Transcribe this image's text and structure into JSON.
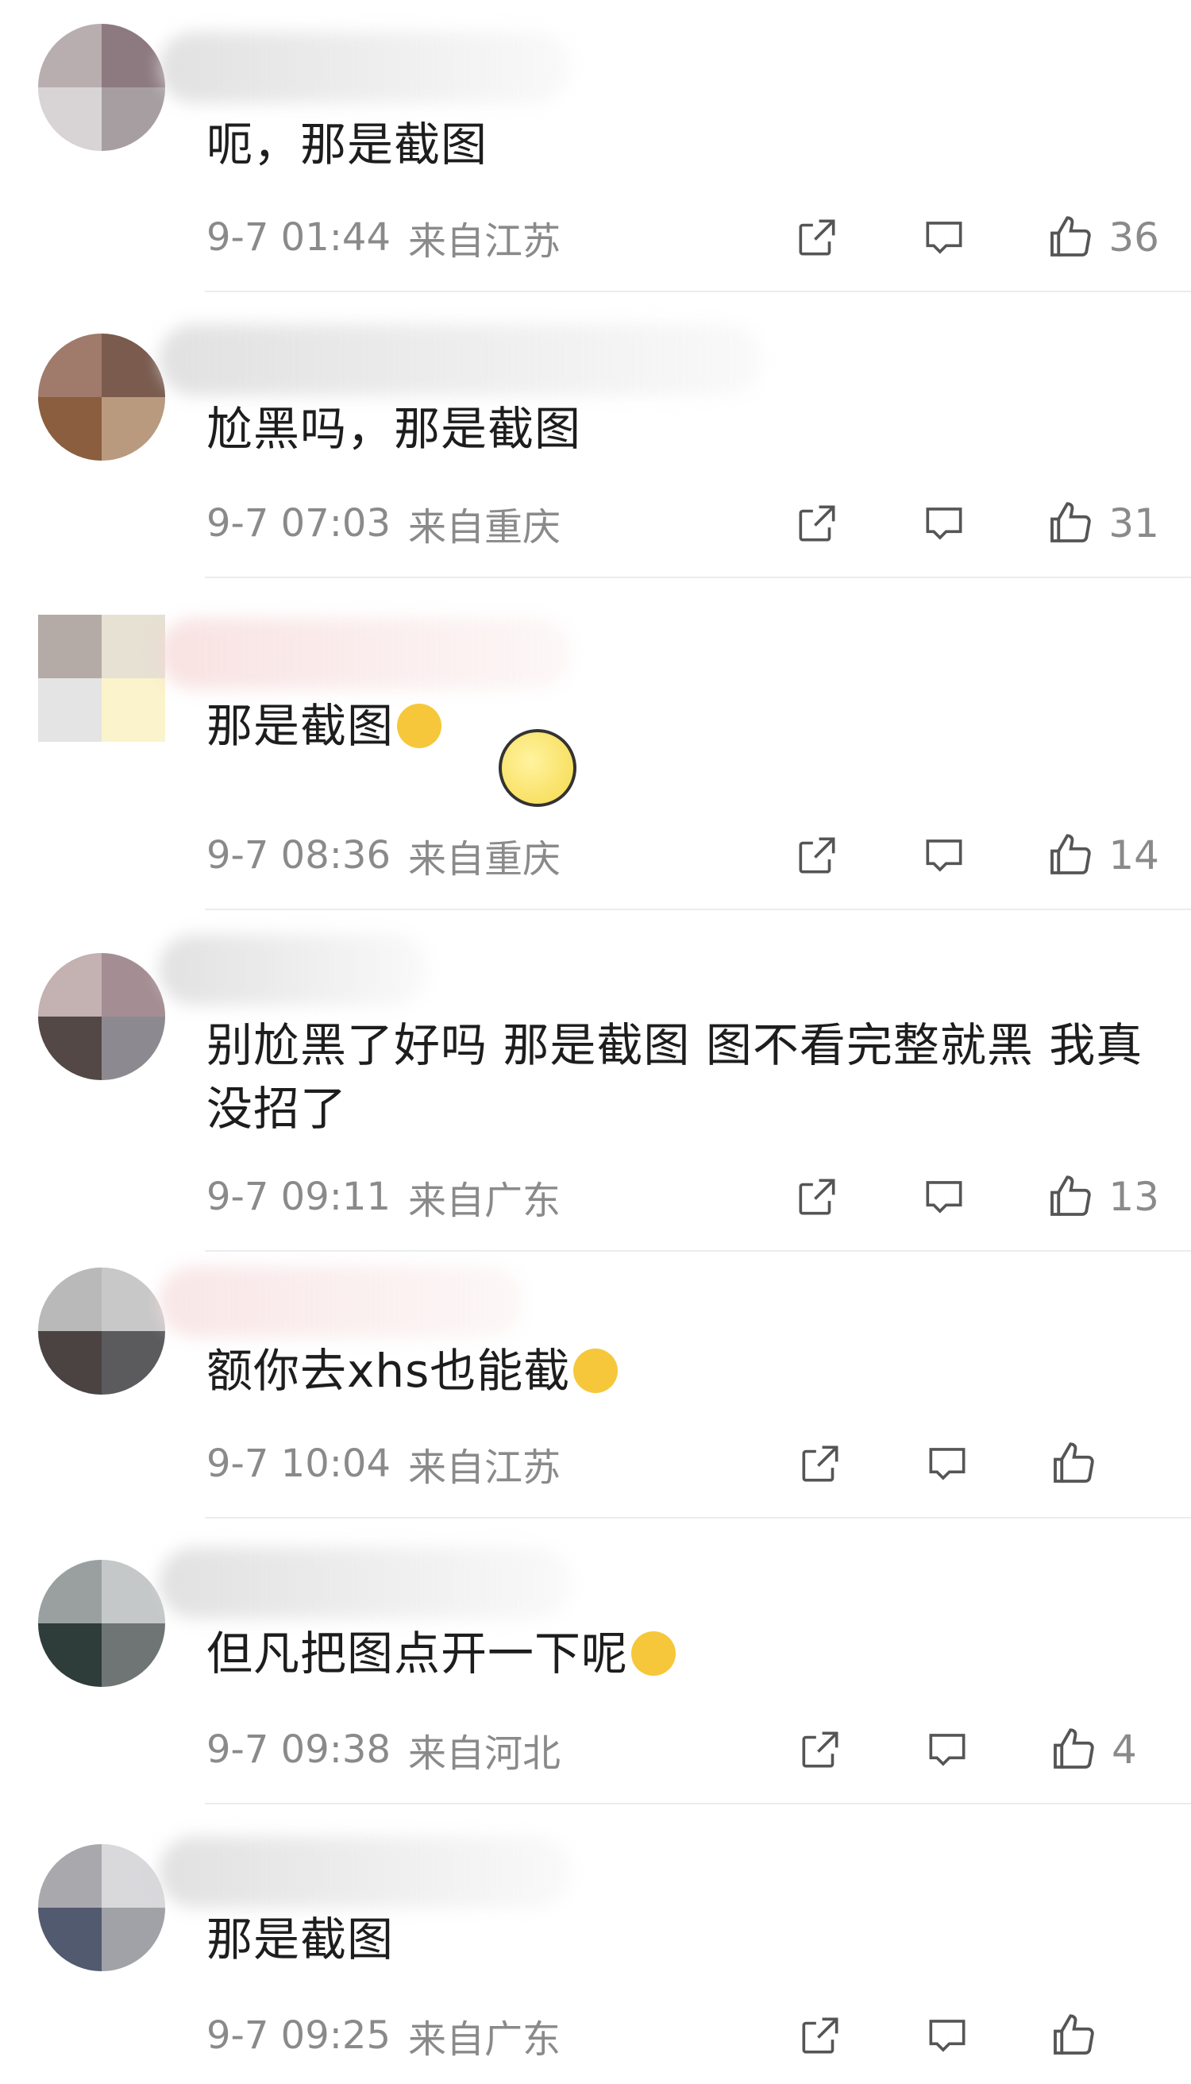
{
  "comments": [
    {
      "text": "呃，那是截图",
      "time": "9-7 01:44",
      "location": "来自江苏",
      "likes": "36"
    },
    {
      "text": "尬黑吗，那是截图",
      "time": "9-7 07:03",
      "location": "来自重庆",
      "likes": "31"
    },
    {
      "text": "那是截图",
      "time": "9-7 08:36",
      "location": "来自重庆",
      "likes": "14"
    },
    {
      "text": "别尬黑了好吗 那是截图 图不看完整就黑 我真没招了",
      "time": "9-7 09:11",
      "location": "来自广东",
      "likes": "13"
    },
    {
      "text": "额你去xhs也能截",
      "time": "9-7 10:04",
      "location": "来自江苏",
      "likes": ""
    },
    {
      "text": "但凡把图点开一下呢",
      "time": "9-7 09:38",
      "location": "来自河北",
      "likes": "4"
    },
    {
      "text": "那是截图",
      "time": "9-7 09:25",
      "location": "来自广东",
      "likes": ""
    }
  ],
  "icons": {
    "share": "share-icon",
    "reply": "comment-icon",
    "like": "thumbs-up-icon"
  },
  "colors": {
    "text": "#1d1d1d",
    "meta": "#8a8a8a",
    "divider": "#ececec"
  }
}
